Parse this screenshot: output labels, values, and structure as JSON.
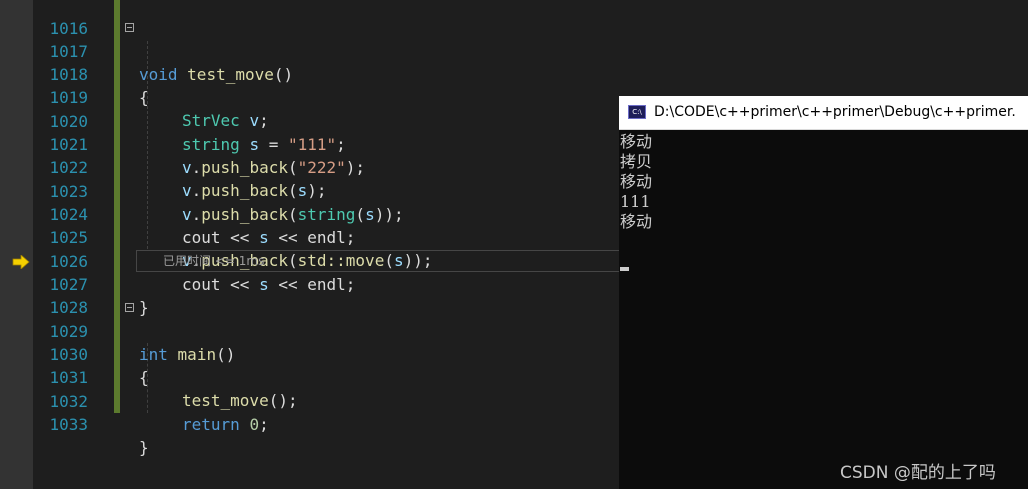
{
  "editor": {
    "line_numbers": [
      "1016",
      "1017",
      "1018",
      "1019",
      "1020",
      "1021",
      "1022",
      "1023",
      "1024",
      "1025",
      "1026",
      "1027",
      "1028",
      "1029",
      "1030",
      "1031",
      "1032",
      "1033"
    ],
    "fn1_kw": "void",
    "fn1_name": "test_move",
    "paren": "()",
    "brace_open": "{",
    "brace_close": "}",
    "l1019_type": "StrVec",
    "l1019_var": "v",
    "semicolon": ";",
    "l1020_type": "string",
    "l1020_var": "s",
    "assign": " = ",
    "l1020_str": "\"111\"",
    "obj_v": "v",
    "dot": ".",
    "push_back": "push_back",
    "open_paren": "(",
    "close_paren": ")",
    "close_paren_semi": ");",
    "l1021_str": "\"222\"",
    "var_s": "s",
    "string_type": "string",
    "cout": "cout",
    "shift": " << ",
    "endl": "endl",
    "std_move": "std::move",
    "elapsed": "已用时间 <= 1ms",
    "fn2_kw": "int",
    "fn2_name": "main",
    "call_test_move": "test_move",
    "call_tail": "();",
    "return_kw": "return",
    "zero": "0"
  },
  "console": {
    "title": "D:\\CODE\\c++primer\\c++primer\\Debug\\c++primer.",
    "icon_label": "C:\\",
    "output_lines": [
      "移动",
      "拷贝",
      "移动",
      "111",
      "移动"
    ]
  },
  "watermark": "CSDN @配的上了吗",
  "icons": [
    "fold-collapse-icon",
    "execution-arrow-icon",
    "console-app-icon"
  ]
}
